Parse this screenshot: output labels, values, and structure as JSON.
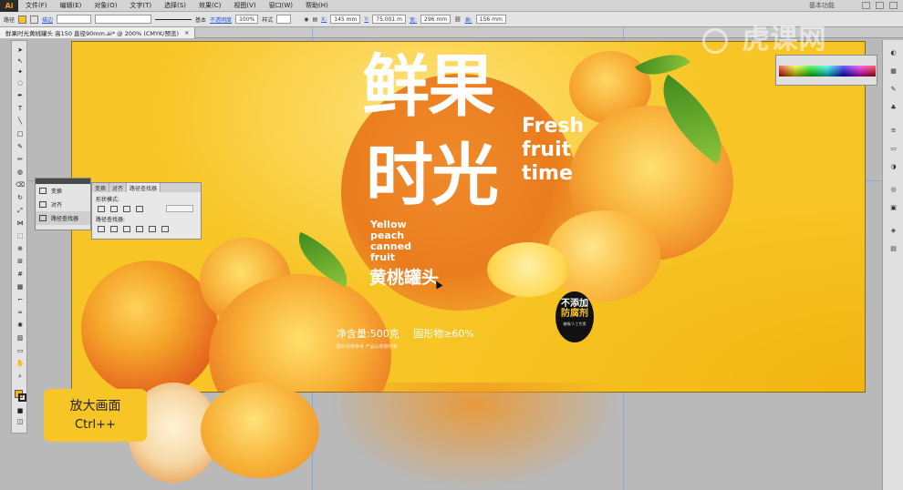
{
  "app": {
    "logo": "Ai",
    "menu": [
      "文件(F)",
      "编辑(E)",
      "对象(O)",
      "文字(T)",
      "选择(S)",
      "效果(C)",
      "视图(V)",
      "窗口(W)",
      "帮助(H)"
    ],
    "workspace": "基本功能"
  },
  "control_bar": {
    "selection_label": "路径",
    "stroke_label": "描边",
    "stroke_style": "基本",
    "opacity_label": "不透明度",
    "opacity_value": "100%",
    "style_label": "样式",
    "x_label": "X:",
    "x_value": "145 mm",
    "y_label": "Y:",
    "y_value": "75.001 m",
    "w_label": "宽:",
    "w_value": "296 mm",
    "h_label": "高:",
    "h_value": "156 mm"
  },
  "document_tab": {
    "title": "鲜果时光黄桃罐头 高150 直径90mm.ai* @ 200% (CMYK/预览)"
  },
  "artwork": {
    "title_line1": "鲜果",
    "title_line2": "时光",
    "english_lines": [
      "Fresh",
      "fruit",
      "time"
    ],
    "subtitle_en": [
      "Yellow",
      "peach",
      "canned",
      "fruit"
    ],
    "product_name": "黄桃罐头",
    "net_content": "净含量:500克",
    "solids": "固形物≥60%",
    "fine_print": "图片仅供参考 产品以实物为准",
    "badge_line1": "不添加",
    "badge_line2": "防腐剂",
    "badge_line3": "糖精/人工色素",
    "colors": {
      "background": "#f7c525",
      "circle": "#ea7d1e",
      "badge": "#111111"
    }
  },
  "panels": {
    "dock_items": [
      "变换",
      "对齐",
      "路径查找器"
    ],
    "pathfinder": {
      "tabs": [
        "变换",
        "对齐",
        "路径查找器"
      ],
      "shape_modes": "形状模式:",
      "pathfinders": "路径查找器:",
      "expand": "扩展"
    }
  },
  "overlay": {
    "hint_line1": "放大画面",
    "hint_line2": "Ctrl++",
    "watermark": "虎课网"
  }
}
